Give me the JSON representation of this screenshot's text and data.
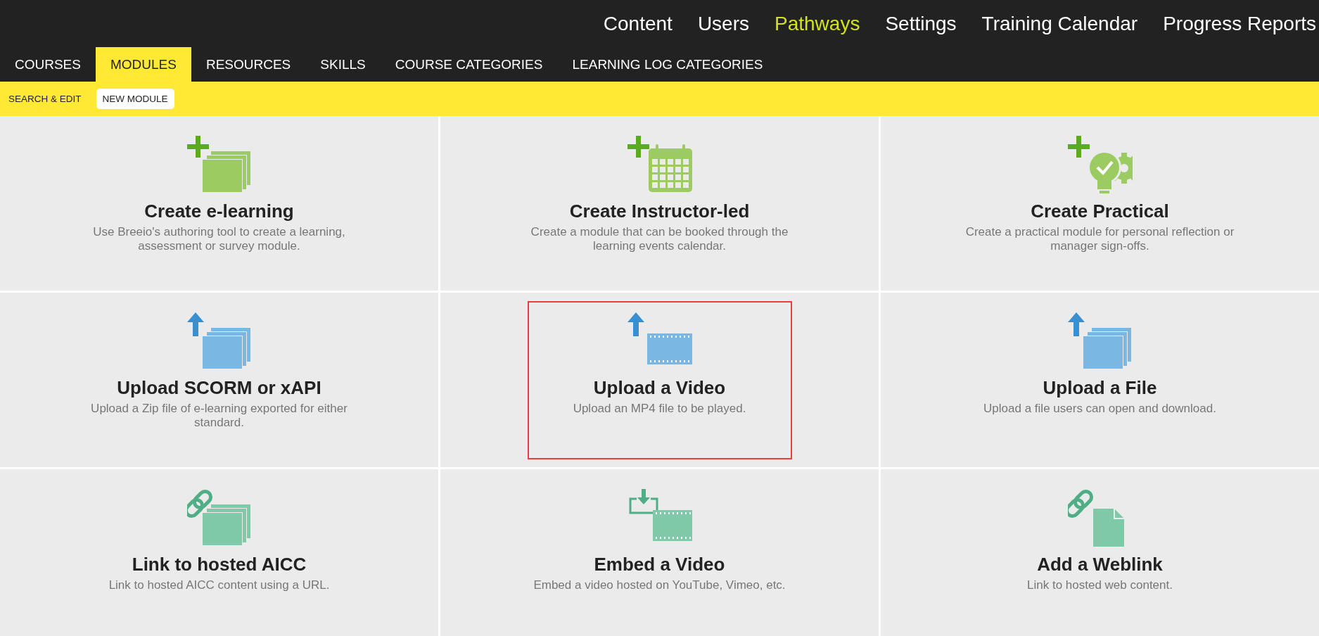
{
  "main_nav": [
    {
      "label": "Content",
      "selected": false
    },
    {
      "label": "Users",
      "selected": false
    },
    {
      "label": "Pathways",
      "selected": true
    },
    {
      "label": "Settings",
      "selected": false
    },
    {
      "label": "Training Calendar",
      "selected": false
    },
    {
      "label": "Progress Reports",
      "selected": false
    }
  ],
  "tabs": [
    {
      "label": "COURSES",
      "selected": false
    },
    {
      "label": "MODULES",
      "selected": true
    },
    {
      "label": "RESOURCES",
      "selected": false
    },
    {
      "label": "SKILLS",
      "selected": false
    },
    {
      "label": "COURSE CATEGORIES",
      "selected": false
    },
    {
      "label": "LEARNING LOG CATEGORIES",
      "selected": false
    }
  ],
  "sub_nav": [
    {
      "label": "SEARCH & EDIT",
      "selected": false
    },
    {
      "label": "NEW MODULE",
      "selected": true
    }
  ],
  "tiles": [
    {
      "kind": "elearning",
      "title": "Create e-learning",
      "description": "Use Breeio's authoring tool to create a learning, assessment or survey module.",
      "selected": false
    },
    {
      "kind": "instructor",
      "title": "Create Instructor-led",
      "description": "Create a module that can be booked through the learning events calendar.",
      "selected": false
    },
    {
      "kind": "practical",
      "title": "Create Practical",
      "description": "Create a practical module for personal reflection or manager sign-offs.",
      "selected": false
    },
    {
      "kind": "scorm",
      "title": "Upload SCORM or xAPI",
      "description": "Upload a Zip file of e-learning exported for either standard.",
      "selected": false
    },
    {
      "kind": "video",
      "title": "Upload a Video",
      "description": "Upload an MP4 file to be played.",
      "selected": true
    },
    {
      "kind": "file",
      "title": "Upload a File",
      "description": "Upload a file users can open and download.",
      "selected": false
    },
    {
      "kind": "aicc",
      "title": "Link to hosted AICC",
      "description": "Link to hosted AICC content using a URL.",
      "selected": false
    },
    {
      "kind": "embed",
      "title": "Embed a Video",
      "description": "Embed a video hosted on YouTube, Vimeo, etc.",
      "selected": false
    },
    {
      "kind": "weblink",
      "title": "Add a Weblink",
      "description": "Link to hosted web content.",
      "selected": false
    }
  ]
}
